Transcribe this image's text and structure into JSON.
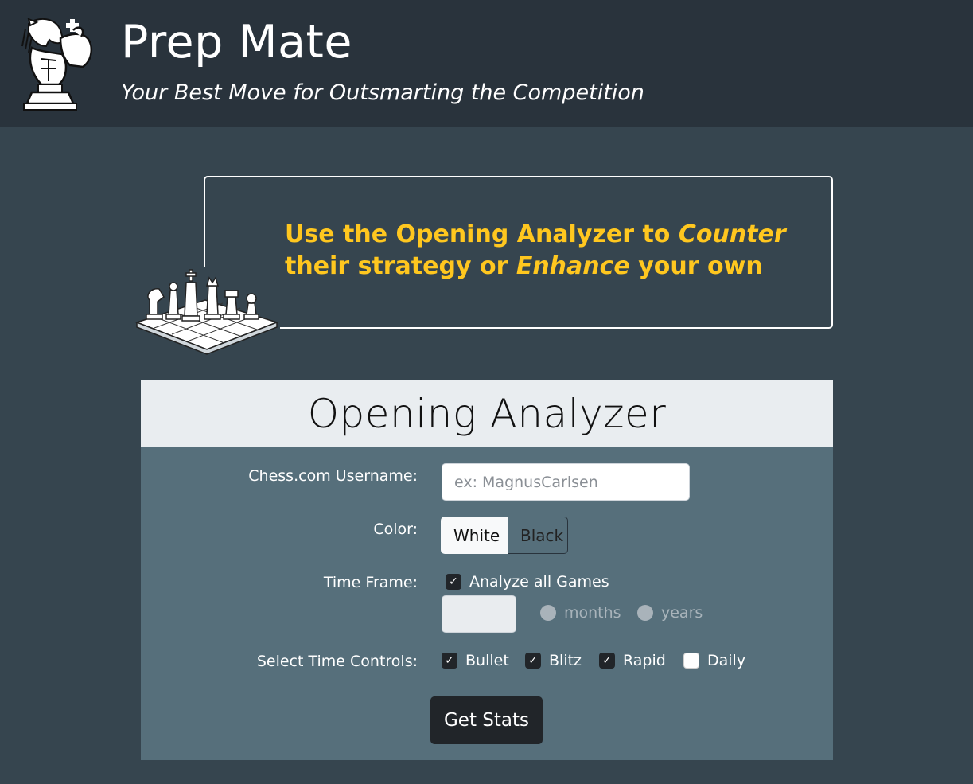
{
  "header": {
    "title": "Prep Mate",
    "tagline": "Your Best Move for Outsmarting the Competition"
  },
  "promo": {
    "line1_start": "Use the Opening Analyzer to ",
    "line1_emphasis": "Counter",
    "line2_start": "their strategy or ",
    "line2_emphasis": "Enhance",
    "line2_end": " your own"
  },
  "form": {
    "title": "Opening Analyzer",
    "username_label": "Chess.com Username:",
    "username_placeholder": "ex: MagnusCarlsen",
    "username_value": "",
    "color_label": "Color:",
    "color_options": [
      "White",
      "Black"
    ],
    "color_selected": "White",
    "time_frame_label": "Time Frame:",
    "analyze_all_label": "Analyze all Games",
    "analyze_all_checked": true,
    "time_frame_value": "",
    "unit_options": [
      "months",
      "years"
    ],
    "time_controls_label": "Select Time Controls:",
    "time_controls": [
      {
        "label": "Bullet",
        "checked": true
      },
      {
        "label": "Blitz",
        "checked": true
      },
      {
        "label": "Rapid",
        "checked": true
      },
      {
        "label": "Daily",
        "checked": false
      }
    ],
    "submit_label": "Get Stats"
  },
  "colors": {
    "header_bg": "#29333c",
    "page_bg": "#36454f",
    "accent_yellow": "#ffc71f",
    "card_bg": "#566f7b"
  }
}
